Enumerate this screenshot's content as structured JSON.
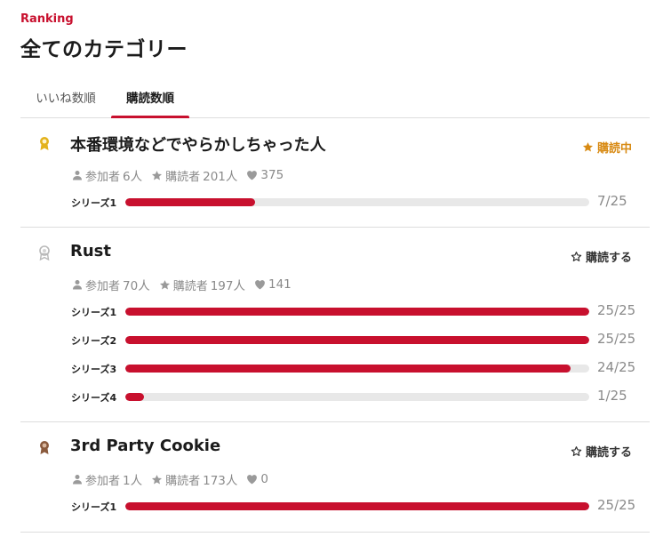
{
  "header": {
    "eyebrow": "Ranking",
    "title": "全てのカテゴリー"
  },
  "tabs": [
    {
      "label": "いいね数順",
      "active": false
    },
    {
      "label": "購読数順",
      "active": true
    }
  ],
  "entries": [
    {
      "rank_icon": "gold-medal-icon",
      "title": "本番環境などでやらかしちゃった人",
      "subscribe_label": "購読中",
      "subscribed": true,
      "participants_label": "参加者",
      "participants": "6人",
      "subscribers_label": "購読者",
      "subscribers": "201人",
      "likes": "375",
      "series": [
        {
          "label": "シリーズ1",
          "done": 7,
          "total": 25,
          "count": "7/25"
        }
      ]
    },
    {
      "rank_icon": "silver-medal-icon",
      "title": "Rust",
      "subscribe_label": "購読する",
      "subscribed": false,
      "participants_label": "参加者",
      "participants": "70人",
      "subscribers_label": "購読者",
      "subscribers": "197人",
      "likes": "141",
      "series": [
        {
          "label": "シリーズ1",
          "done": 25,
          "total": 25,
          "count": "25/25"
        },
        {
          "label": "シリーズ2",
          "done": 25,
          "total": 25,
          "count": "25/25"
        },
        {
          "label": "シリーズ3",
          "done": 24,
          "total": 25,
          "count": "24/25"
        },
        {
          "label": "シリーズ4",
          "done": 1,
          "total": 25,
          "count": "1/25"
        }
      ]
    },
    {
      "rank_icon": "bronze-medal-icon",
      "title": "3rd Party Cookie",
      "subscribe_label": "購読する",
      "subscribed": false,
      "participants_label": "参加者",
      "participants": "1人",
      "subscribers_label": "購読者",
      "subscribers": "173人",
      "likes": "0",
      "series": [
        {
          "label": "シリーズ1",
          "done": 25,
          "total": 25,
          "count": "25/25"
        }
      ]
    }
  ],
  "colors": {
    "accent": "#c8102e",
    "subscribed": "#d88a13",
    "gold": "#e3b21c",
    "silver": "#b9b9b9",
    "bronze": "#8a5a3c",
    "track": "#e8e8e8",
    "muted": "#8a8a8a"
  }
}
